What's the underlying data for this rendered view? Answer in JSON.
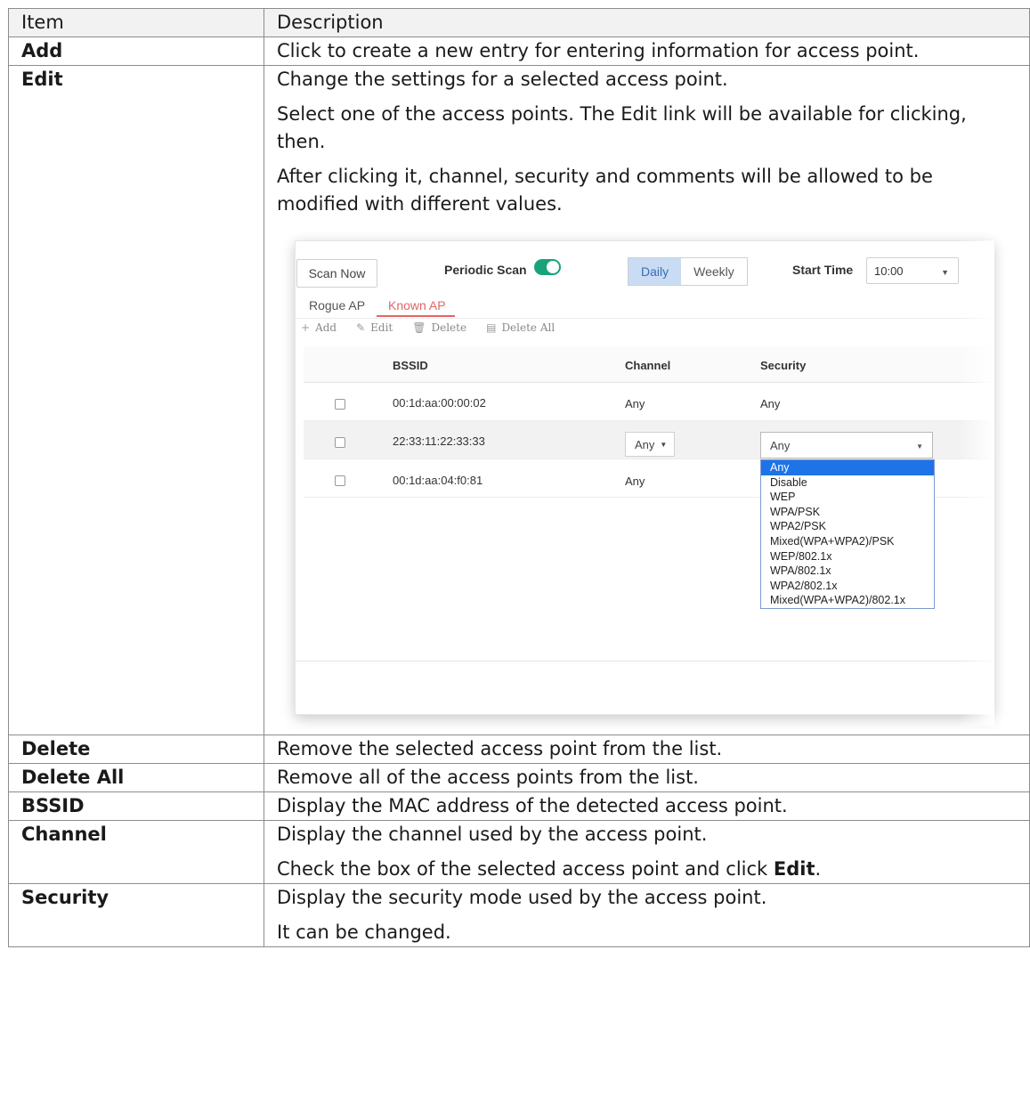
{
  "table": {
    "header": {
      "item": "Item",
      "description": "Description"
    },
    "rows": {
      "add": {
        "item": "Add",
        "desc": "Click to create a new entry for entering information for access point."
      },
      "edit": {
        "item": "Edit",
        "p1": "Change the settings for a selected access point.",
        "p2": "Select one of the access points. The Edit link will be available for clicking, then.",
        "p3": "After clicking it, channel, security and comments will be allowed to be modified with different values."
      },
      "delete": {
        "item": "Delete",
        "desc": "Remove the selected access point from the list."
      },
      "delete_all": {
        "item": "Delete All",
        "desc": "Remove all of the access points from the list."
      },
      "bssid": {
        "item": "BSSID",
        "desc": "Display the MAC address of the detected access point."
      },
      "channel": {
        "item": "Channel",
        "p1": "Display the channel used by the access point.",
        "p2_prefix": "Check the box of the selected access point and click ",
        "p2_bold": "Edit",
        "p2_suffix": "."
      },
      "security": {
        "item": "Security",
        "p1": "Display the security mode used by the access point.",
        "p2": "It can be changed."
      }
    }
  },
  "screenshot": {
    "scan_now": "Scan Now",
    "periodic_scan": "Periodic Scan",
    "periodic_on": true,
    "daily": "Daily",
    "weekly": "Weekly",
    "start_time_label": "Start Time",
    "start_time_value": "10:00",
    "tab_rogue": "Rogue AP",
    "tab_known": "Known AP",
    "tool_add": "Add",
    "tool_edit": "Edit",
    "tool_delete": "Delete",
    "tool_delete_all": "Delete All",
    "col_bssid": "BSSID",
    "col_channel": "Channel",
    "col_security": "Security",
    "rows": [
      {
        "bssid": "00:1d:aa:00:00:02",
        "channel": "Any",
        "security": "Any"
      },
      {
        "bssid": "22:33:11:22:33:33",
        "channel": "Any",
        "security": "Any"
      },
      {
        "bssid": "00:1d:aa:04:f0:81",
        "channel": "Any",
        "security": ""
      }
    ],
    "security_options": [
      "Any",
      "Disable",
      "WEP",
      "WPA/PSK",
      "WPA2/PSK",
      "Mixed(WPA+WPA2)/PSK",
      "WEP/802.1x",
      "WPA/802.1x",
      "WPA2/802.1x",
      "Mixed(WPA+WPA2)/802.1x"
    ],
    "accent_color": "#1aa37a",
    "tab_active_color": "#e06666"
  }
}
